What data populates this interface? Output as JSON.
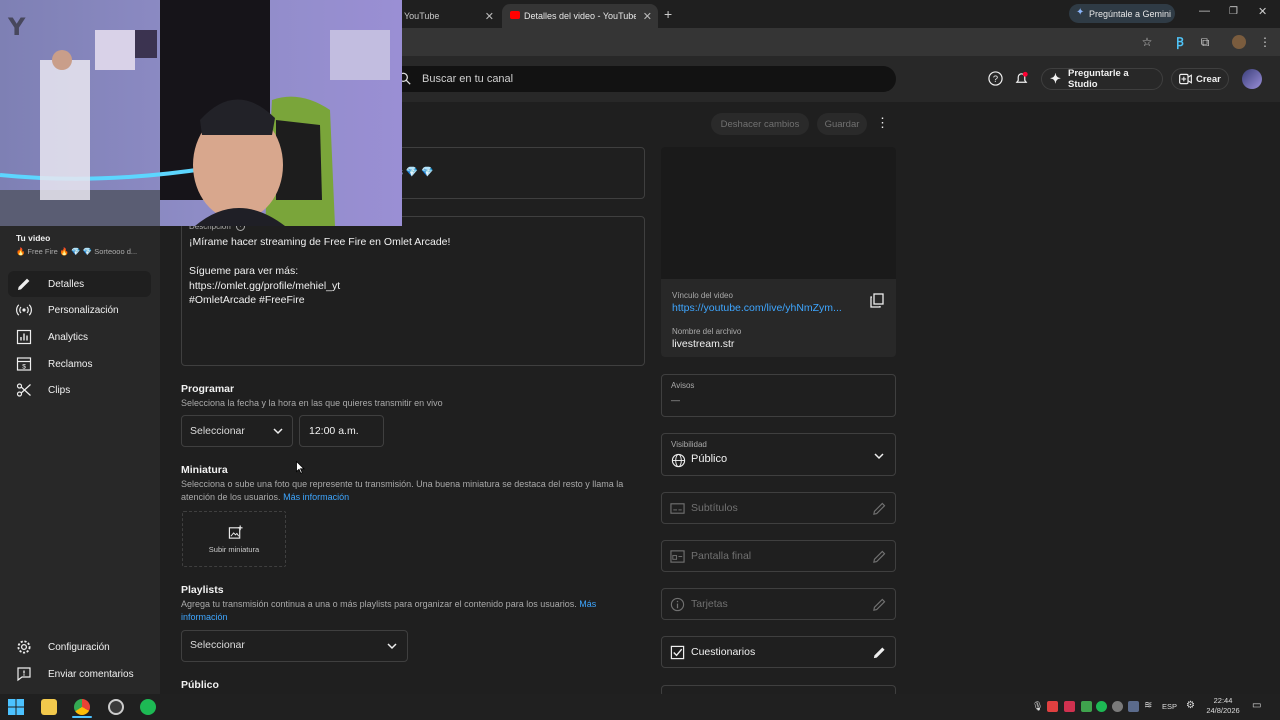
{
  "browser": {
    "tabs": [
      {
        "title": "YouTube"
      },
      {
        "title": "Detalles del video - YouTube Stu"
      }
    ],
    "gemini_button": "Pregúntale a Gemini"
  },
  "header": {
    "search_placeholder": "Buscar en tu canal",
    "ask_studio": "Preguntarle a Studio",
    "create": "Crear"
  },
  "sidebar": {
    "your_video": "Tu video",
    "video_title": "🔥 Free Fire 🔥 💎 💎 Sorteooo d...",
    "items": [
      {
        "label": "Detalles"
      },
      {
        "label": "Personalización"
      },
      {
        "label": "Analytics"
      },
      {
        "label": "Reclamos"
      },
      {
        "label": "Clips"
      }
    ],
    "settings": "Configuración",
    "feedback": "Enviar comentarios"
  },
  "main": {
    "undo": "Deshacer cambios",
    "save": "Guardar",
    "title_suffix": "s 💎 💎",
    "description_label": "Descripción",
    "description_lines": [
      "¡Mírame hacer streaming de Free Fire en Omlet Arcade!",
      "",
      "Sígueme para ver más:",
      "https://omlet.gg/profile/mehiel_yt",
      "#OmletArcade #FreeFire"
    ],
    "schedule": {
      "title": "Programar",
      "subtitle": "Selecciona la fecha y la hora en las que quieres transmitir en vivo",
      "date_select": "Seleccionar",
      "time": "12:00 a.m."
    },
    "thumbnail": {
      "title": "Miniatura",
      "subtitle_1": "Selecciona o sube una foto que represente tu transmisión. Una buena miniatura se destaca del resto y llama la",
      "subtitle_2": "atención de los usuarios.",
      "more_info": "Más información",
      "upload": "Subir miniatura"
    },
    "playlists": {
      "title": "Playlists",
      "subtitle_1": "Agrega tu transmisión continua a una o más playlists para organizar el contenido para los usuarios.",
      "more_info_1": "Más",
      "more_info_2": "información",
      "select": "Seleccionar"
    },
    "audience_title": "Público"
  },
  "right_panel": {
    "video_link_label": "Vínculo del video",
    "video_link": "https://youtube.com/live/yhNmZym...",
    "file_name_label": "Nombre del archivo",
    "file_name": "livestream.str",
    "notices_label": "Avisos",
    "notices_value": "—",
    "visibility_label": "Visibilidad",
    "visibility_value": "Público",
    "subtitles": "Subtítulos",
    "end_screen": "Pantalla final",
    "cards": "Tarjetas",
    "quizzes": "Cuestionarios"
  },
  "taskbar": {
    "lang": "ESP",
    "time": "22:44",
    "date": "24/8/2026"
  },
  "colors": {
    "accent_link": "#3ea6ff",
    "background": "#1f1f1f",
    "panel": "#282828"
  }
}
